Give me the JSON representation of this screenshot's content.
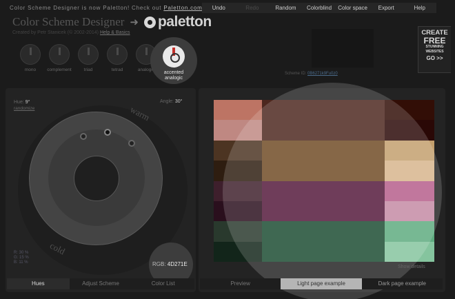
{
  "header": {
    "notice_prefix": "Color Scheme Designer is now Paletton! Check out",
    "notice_link": "Paletton.com",
    "old_title": "Color Scheme Designer",
    "brand": "paletton",
    "subline_text": "Created by Petr Stanicek (© 2002-2014)",
    "subline_link": "Help & Basics"
  },
  "menu": [
    {
      "label": "Undo",
      "enabled": true
    },
    {
      "label": "Redo",
      "enabled": false
    },
    {
      "label": "Random",
      "enabled": true
    },
    {
      "label": "Colorblind",
      "enabled": true
    },
    {
      "label": "Color space",
      "enabled": true
    },
    {
      "label": "Export",
      "enabled": true
    },
    {
      "label": "Help",
      "enabled": true
    }
  ],
  "schemes": [
    "mono",
    "complement",
    "triad",
    "tetrad",
    "analogic"
  ],
  "active_scheme": {
    "line1": "accented",
    "line2": "analogic"
  },
  "scheme_id": {
    "label": "Scheme ID:",
    "value": "0B6271k9Fu0z0"
  },
  "ad": {
    "l1": "CREATE",
    "l2": "FREE",
    "l3": "STUNNING",
    "l4": "WEBSITES",
    "l5": "GO >>"
  },
  "controls": {
    "hue_label": "Hue:",
    "hue_value": "9°",
    "randomize": "randomize",
    "angle_label": "Angle:",
    "angle_value": "30°",
    "warm": "warm",
    "cold": "cold",
    "rgb_r": "R: 30 %",
    "rgb_g": "G: 15 %",
    "rgb_b": "B: 11 %",
    "rgb_label": "RGB:",
    "rgb_value": "4D271E"
  },
  "tabs_left": [
    "Hues",
    "Adjust Scheme",
    "Color List"
  ],
  "tabs_right": [
    "Preview",
    "Light page example",
    "Dark page example"
  ],
  "show_link": "Show details",
  "swatch_colors": [
    [
      "#bd7464",
      "#4d271e",
      "#4d271e",
      "#320e06"
    ],
    [
      "#bf8882",
      "#4d271e",
      "#4d271e",
      "#2a0806"
    ],
    [
      "#4c3422",
      "#6f4a24",
      "#6f4a24",
      "#c39f6d"
    ],
    [
      "#2e1d10",
      "#6f4a24",
      "#6f4a24",
      "#d7b48c"
    ],
    [
      "#3e1f2c",
      "#54193b",
      "#54193b",
      "#b55e8b"
    ],
    [
      "#2a0f1d",
      "#54193b",
      "#54193b",
      "#c48aa4"
    ],
    [
      "#29392d",
      "#1b4c32",
      "#1b4c32",
      "#5eab7f"
    ],
    [
      "#12251a",
      "#1b4c32",
      "#1b4c32",
      "#85c49e"
    ]
  ]
}
